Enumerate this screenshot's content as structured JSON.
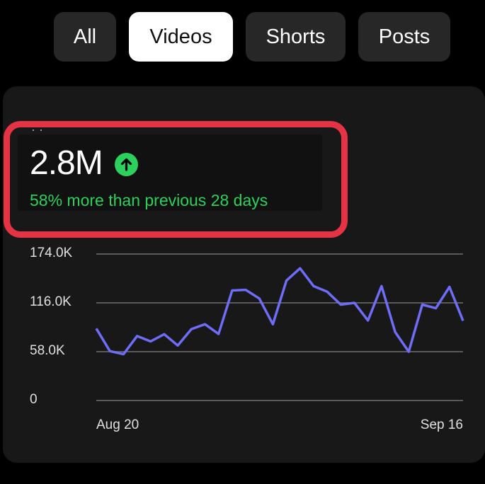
{
  "filter_chips": [
    {
      "label": "All",
      "selected": false
    },
    {
      "label": "Videos",
      "selected": true
    },
    {
      "label": "Shorts",
      "selected": false
    },
    {
      "label": "Posts",
      "selected": false
    }
  ],
  "metric": {
    "value": "2.8M",
    "trend_icon": "arrow-up-circle-icon",
    "comparison": "58% more than previous 28 days",
    "trend_color": "#2bd15c"
  },
  "highlight_color": "#e33344",
  "chart_data": {
    "type": "line",
    "x_tick_labels": [
      "Aug 20",
      "Sep 16"
    ],
    "y_tick_labels": [
      "174.0K",
      "116.0K",
      "58.0K",
      "0"
    ],
    "y_ticks": [
      174000,
      116000,
      58000,
      0
    ],
    "ylim": [
      0,
      174000
    ],
    "grid": true,
    "line_color": "#6f6cf7",
    "series": [
      {
        "values": [
          85500,
          58700,
          55000,
          76600,
          70200,
          78800,
          65300,
          84800,
          90600,
          79100,
          130700,
          131500,
          121200,
          90600,
          142600,
          157000,
          135800,
          129200,
          113900,
          116000,
          95100,
          135800,
          81400,
          58000,
          113900,
          109600,
          134900,
          94700
        ]
      }
    ]
  }
}
